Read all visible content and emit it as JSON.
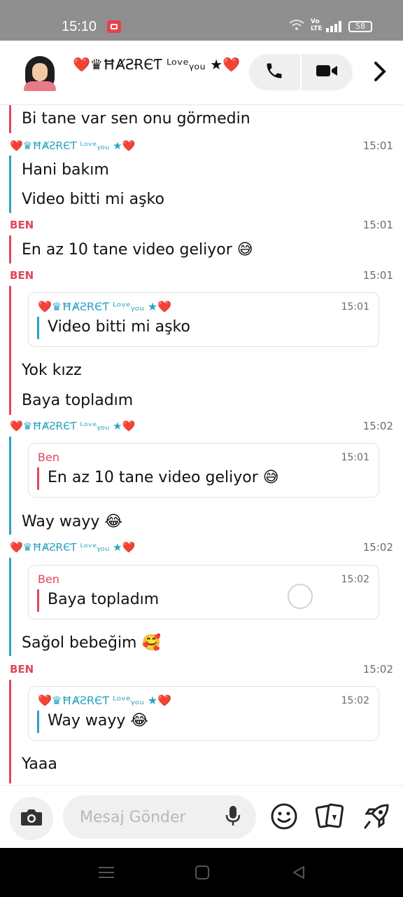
{
  "status_bar": {
    "time": "15:10",
    "network_label": "Vo\nLTE",
    "battery": "58"
  },
  "header": {
    "contact_name": "❤️♛ĦȺƧɌЄƬ ᴸᵒᵛᵉᵧₒᵤ ★❤️",
    "voice_call_icon": "phone-icon",
    "video_call_icon": "video-camera-icon",
    "next_icon": "chevron-right-icon"
  },
  "contact_short": "❤️♛ĦȺƧɌЄƬ ᴸᵒᵛᵉᵧₒᵤ ★❤️",
  "chat": {
    "m0": "Bi tane var sen onu görmedin",
    "s1": {
      "name": "❤️♛ĦȺƧɌЄƬ ᴸᵒᵛᵉᵧₒᵤ ★❤️",
      "time": "15:01"
    },
    "m1a": "Hani bakım",
    "m1b": "Video bitti mi aşko",
    "s2": {
      "name": "BEN",
      "time": "15:01"
    },
    "m2": "En az 10 tane video geliyor 😅",
    "s3": {
      "name": "BEN",
      "time": "15:01"
    },
    "q3": {
      "name": "❤️♛ĦȺƧɌЄƬ ᴸᵒᵛᵉᵧₒᵤ ★❤️",
      "time": "15:01",
      "text": "Video bitti mi aşko"
    },
    "m3a": "Yok kızz",
    "m3b": "Baya topladım",
    "s4": {
      "name": "❤️♛ĦȺƧɌЄƬ ᴸᵒᵛᵉᵧₒᵤ ★❤️",
      "time": "15:02"
    },
    "q4": {
      "name": "Ben",
      "time": "15:01",
      "text": "En az 10 tane video geliyor 😅"
    },
    "m4": "Way wayy 😂",
    "s5": {
      "name": "❤️♛ĦȺƧɌЄƬ ᴸᵒᵛᵉᵧₒᵤ ★❤️",
      "time": "15:02"
    },
    "q5": {
      "name": "Ben",
      "time": "15:02",
      "text": "Baya topladım"
    },
    "m5": "Sağol bebeğim 🥰",
    "s6": {
      "name": "BEN",
      "time": "15:02"
    },
    "q6": {
      "name": "❤️♛ĦȺƧɌЄƬ ᴸᵒᵛᵉᵧₒᵤ ★❤️",
      "time": "15:02",
      "text": "Way wayy 😂"
    },
    "m6": "Yaaa"
  },
  "composer": {
    "placeholder": "Mesaj Gönder",
    "camera_icon": "camera-icon",
    "mic_icon": "microphone-icon",
    "emoji_icon": "smiley-icon",
    "sticker_icon": "cards-icon",
    "games_icon": "rocket-icon"
  },
  "colors": {
    "her": "#2aa3c3",
    "me": "#e0475b",
    "status_bar": "#8f8f8f"
  }
}
